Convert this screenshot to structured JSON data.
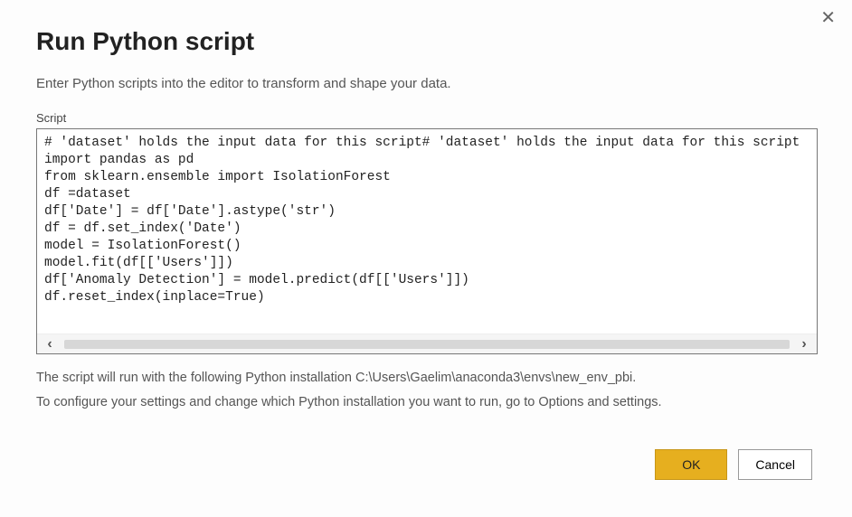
{
  "dialog": {
    "title": "Run Python script",
    "subtitle": "Enter Python scripts into the editor to transform and shape your data.",
    "scriptLabel": "Script",
    "scriptContent": "# 'dataset' holds the input data for this script# 'dataset' holds the input data for this script\nimport pandas as pd\nfrom sklearn.ensemble import IsolationForest\ndf =dataset\ndf['Date'] = df['Date'].astype('str')\ndf = df.set_index('Date')\nmodel = IsolationForest()\nmodel.fit(df[['Users']])\ndf['Anomaly Detection'] = model.predict(df[['Users']])\ndf.reset_index(inplace=True)",
    "infoLine1": "The script will run with the following Python installation C:\\Users\\Gaelim\\anaconda3\\envs\\new_env_pbi.",
    "infoLine2": "To configure your settings and change which Python installation you want to run, go to Options and settings.",
    "okLabel": "OK",
    "cancelLabel": "Cancel",
    "closeGlyph": "✕",
    "scrollLeftGlyph": "‹",
    "scrollRightGlyph": "›"
  }
}
